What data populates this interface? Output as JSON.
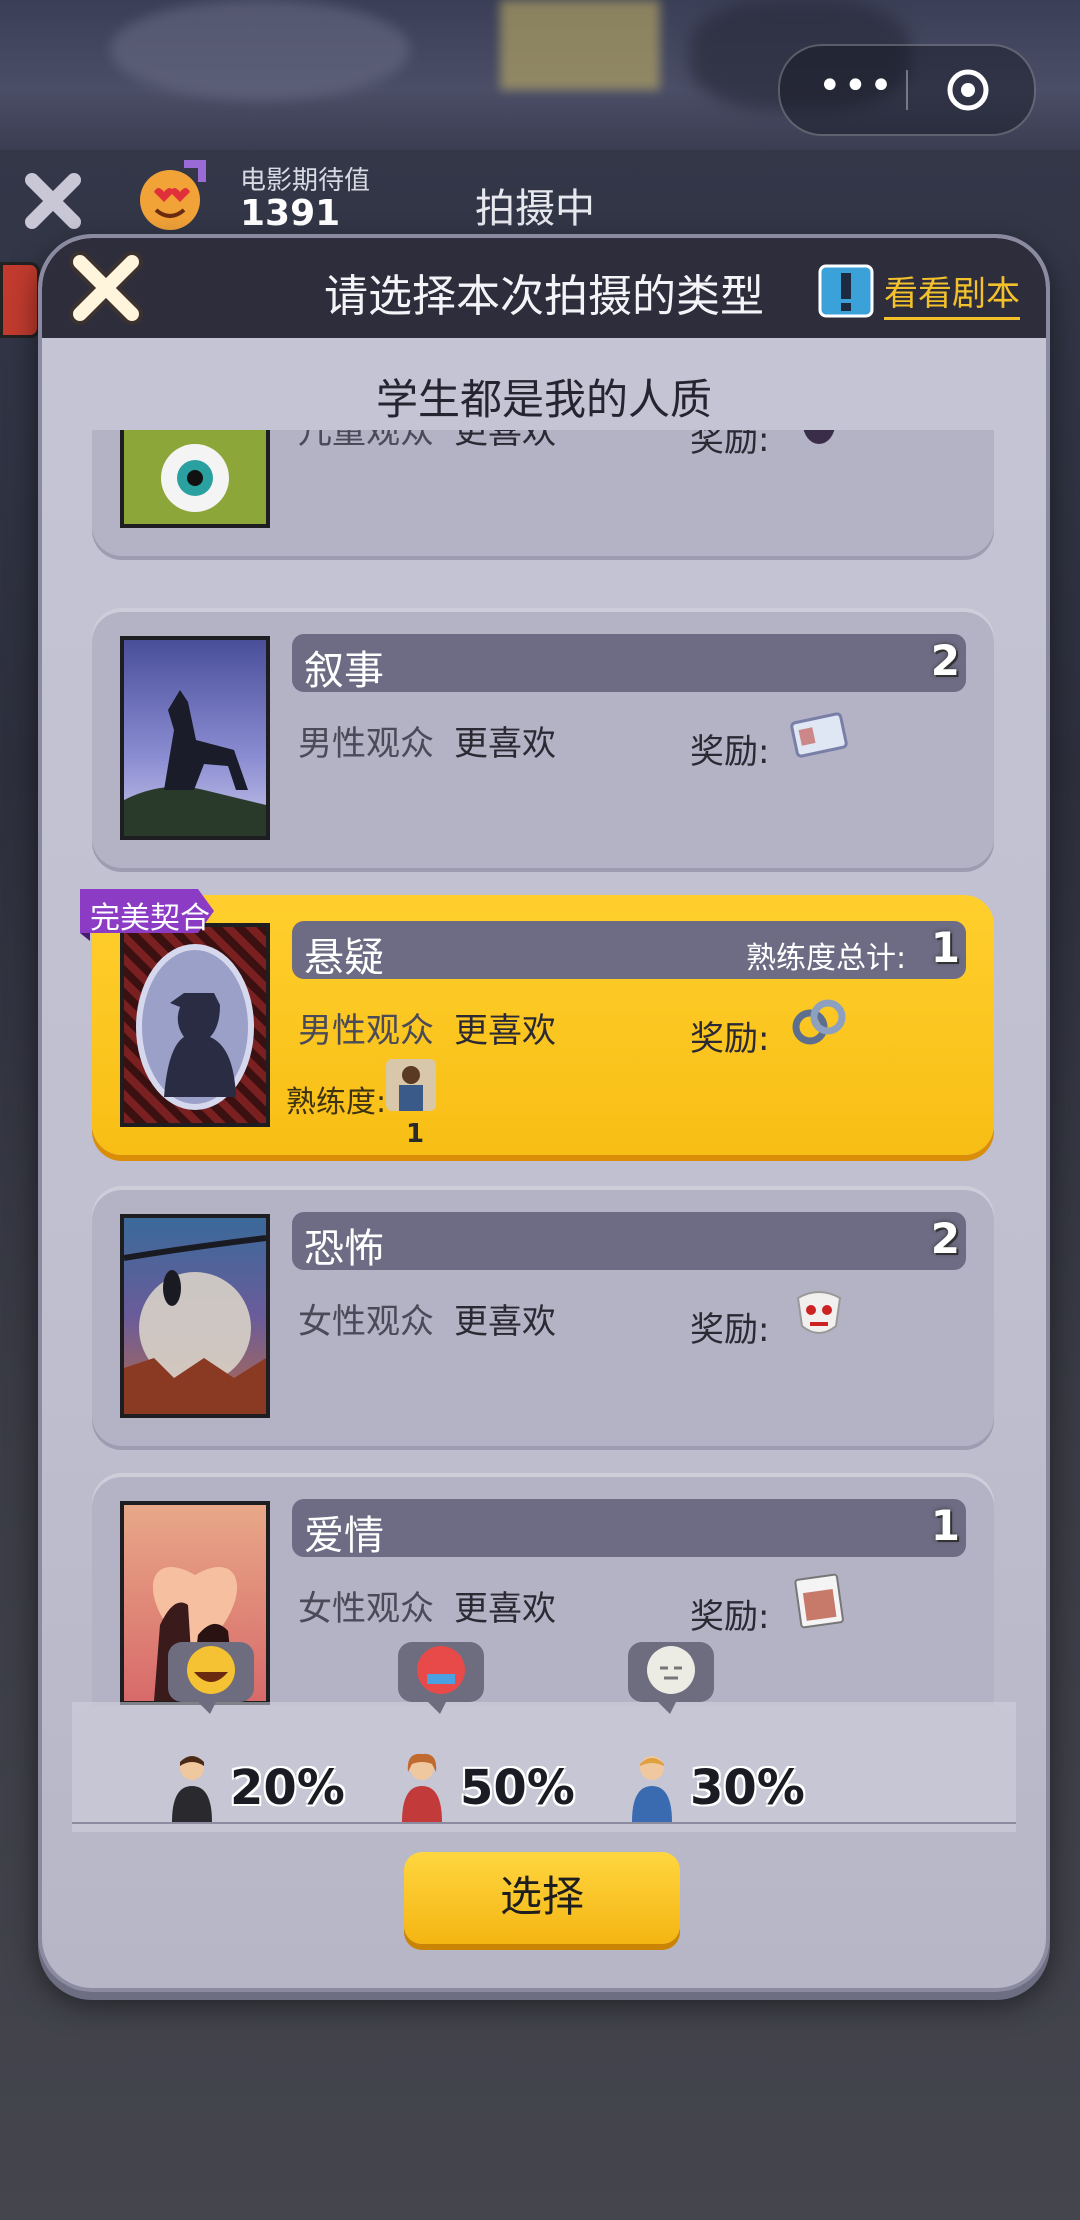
{
  "hud": {
    "expectation_label": "电影期待值",
    "expectation_value": "1391",
    "status": "拍摄中"
  },
  "modal": {
    "title": "请选择本次拍摄的类型",
    "script_link": "看看剧本",
    "movie_name": "学生都是我的人质"
  },
  "genres": [
    {
      "name": "",
      "count": "",
      "audience": "儿童观众",
      "preference": "更喜欢",
      "reward_label": "奖励:",
      "reward_icon": "monster-figure-icon"
    },
    {
      "name": "叙事",
      "count": "2",
      "audience": "男性观众",
      "preference": "更喜欢",
      "reward_label": "奖励:",
      "reward_icon": "id-card-icon"
    },
    {
      "name": "悬疑",
      "badge": "完美契合",
      "total_label": "熟练度总计:",
      "count": "1",
      "audience": "男性观众",
      "preference": "更喜欢",
      "reward_label": "奖励:",
      "reward_icon": "handcuffs-icon",
      "proficiency_label": "熟练度:",
      "proficiency_count": "1",
      "selected": true
    },
    {
      "name": "恐怖",
      "count": "2",
      "audience": "女性观众",
      "preference": "更喜欢",
      "reward_label": "奖励:",
      "reward_icon": "horror-mask-icon"
    },
    {
      "name": "爱情",
      "count": "1",
      "audience": "女性观众",
      "preference": "更喜欢",
      "reward_label": "奖励:",
      "reward_icon": "love-poster-icon"
    }
  ],
  "audience_stats": [
    {
      "group": "child",
      "percent": "20%",
      "mood": "laughing-face-icon"
    },
    {
      "group": "female",
      "percent": "50%",
      "mood": "angry-face-icon"
    },
    {
      "group": "male",
      "percent": "30%",
      "mood": "neutral-face-icon"
    }
  ],
  "select_button": "选择",
  "colors": {
    "accent": "#f8be15",
    "header": "#2e2d3c",
    "genre_bar": "#6d6c84",
    "link": "#f3c12c"
  }
}
